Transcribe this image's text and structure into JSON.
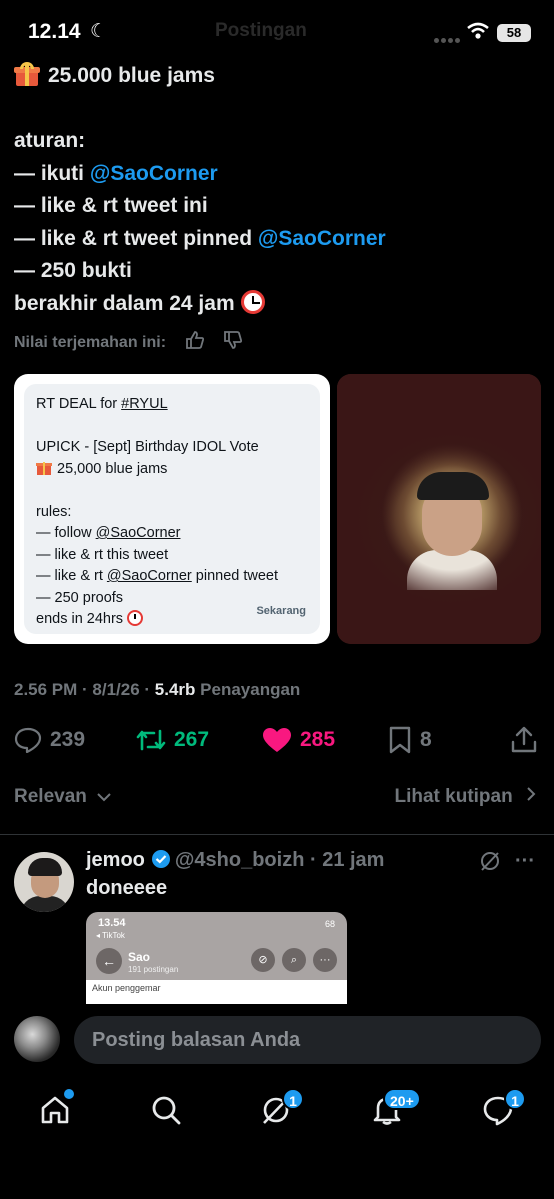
{
  "status_bar": {
    "time": "12.14",
    "faded_header": "Postingan",
    "battery": "58"
  },
  "tweet": {
    "line1_text": "25.000 blue jams",
    "line2": "aturan:",
    "line3_prefix": "— ikuti ",
    "line3_mention": "@SaoCorner",
    "line4": "— like & rt tweet ini",
    "line5_prefix": "— like & rt tweet pinned ",
    "line5_mention": "@SaoCorner",
    "line6": "— 250 bukti",
    "line7": "berakhir dalam 24 jam",
    "translate_rating": "Nilai terjemahan ini:"
  },
  "image_card": {
    "l1_prefix": "RT DEAL for ",
    "l1_tag": "#RYUL",
    "l2": "UPICK - [Sept] Birthday IDOL Vote",
    "l3": "25,000 blue jams",
    "l4": "rules:",
    "l5_prefix": "— follow ",
    "l5_mention": "@SaoCorner",
    "l6": "— like & rt this tweet",
    "l7_prefix": "— like & rt ",
    "l7_mention": "@SaoCorner",
    "l7_suffix": "  pinned tweet",
    "l8": "— 250 proofs",
    "l9": "ends in 24hrs",
    "timestamp": "Sekarang"
  },
  "meta": {
    "time": "2.56 PM",
    "sep1": " · ",
    "date": "8/1/26",
    "sep2": " · ",
    "views": "5.4rb",
    "views_label": " Penayangan"
  },
  "actions": {
    "replies": "239",
    "retweets": "267",
    "likes": "285",
    "bookmarks": "8"
  },
  "sort": {
    "relevance": "Relevan",
    "quotes": "Lihat kutipan"
  },
  "reply": {
    "name": "jemoo",
    "handle": "@4sho_boizh",
    "time": " · 21 jam",
    "text": "doneeee",
    "shot": {
      "time": "13.54",
      "app": "◂ TikTok",
      "battery": "68",
      "name": "Sao",
      "posts": "191 postingan",
      "akun": "Akun penggemar"
    }
  },
  "composer": {
    "placeholder": "Posting balasan Anda"
  },
  "nav": {
    "grok_badge": "1",
    "notif_badge": "20+",
    "messages_badge": "1"
  },
  "colors": {
    "accent": "#1d9bf0",
    "retweet": "#00ba7c",
    "like": "#f91880",
    "muted": "#71767b"
  }
}
